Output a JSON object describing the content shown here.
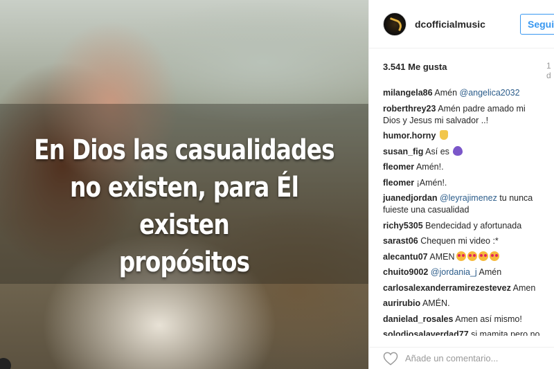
{
  "post": {
    "quote_lines": [
      "En Dios las casualidades",
      "no existen, para Él existen",
      "propósitos"
    ]
  },
  "header": {
    "username": "dcofficialmusic",
    "follow_label": "Seguir"
  },
  "stats": {
    "likes": "3.541 Me gusta",
    "time": "1 d"
  },
  "comments": [
    {
      "user": "milangela86",
      "text": "Amén ",
      "mention": "@angelica2032",
      "after": ""
    },
    {
      "user": "roberthrey23",
      "text": "Amén padre amado mi Dios y Jesus mi salvador ..!",
      "mention": "",
      "after": ""
    },
    {
      "user": "humor.horny",
      "text": "",
      "mention": "",
      "after": "",
      "emoji": "thumbs-up"
    },
    {
      "user": "susan_fig",
      "text": "Así es",
      "mention": "",
      "after": "",
      "emoji": "purple-heart"
    },
    {
      "user": "fleomer",
      "text": "Amén!.",
      "mention": "",
      "after": ""
    },
    {
      "user": "fleomer",
      "text": "¡Amén!.",
      "mention": "",
      "after": ""
    },
    {
      "user": "juanedjordan",
      "text": "",
      "mention": "@leyrajimenez",
      "after": " tu nunca fuieste una casualidad"
    },
    {
      "user": "richy5305",
      "text": "Bendecidad y afortunada",
      "mention": "",
      "after": ""
    },
    {
      "user": "sarast06",
      "text": "Chequen mi video :*",
      "mention": "",
      "after": ""
    },
    {
      "user": "alecantu07",
      "text": "AMEN",
      "mention": "",
      "after": "",
      "emoji": "heart-eyes-x4"
    },
    {
      "user": "chuito9002",
      "text": "",
      "mention": "@jordania_j",
      "after": " Amén"
    },
    {
      "user": "carlosalexanderramirezestevez",
      "text": "Amen",
      "mention": "",
      "after": ""
    },
    {
      "user": "aurirubio",
      "text": "AMÉN.",
      "mention": "",
      "after": ""
    },
    {
      "user": "danielad_rosales",
      "text": "Amen así mismo!",
      "mention": "",
      "after": ""
    },
    {
      "user": "solodiosalaverdad77",
      "text": "si mamita pero no",
      "mention": "",
      "after": ""
    }
  ],
  "footer": {
    "comment_placeholder": "Añade un comentario..."
  }
}
